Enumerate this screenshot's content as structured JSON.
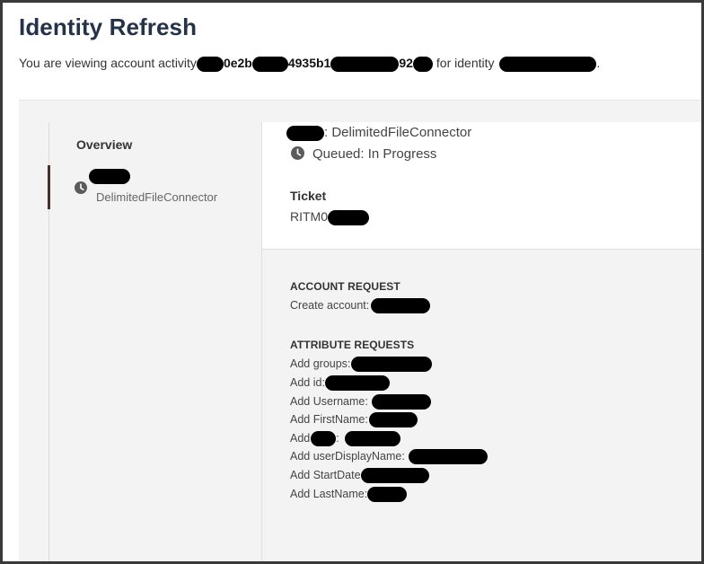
{
  "header": {
    "title": "Identity Refresh",
    "subtitle_prefix": "You are viewing account activity",
    "id_fragment_1": "0e2b",
    "id_fragment_2": "4935b1",
    "id_fragment_3": "92",
    "subtitle_middle": "for identity",
    "subtitle_end": "."
  },
  "nav": {
    "overview_label": "Overview",
    "active_item_subtitle": "DelimitedFileConnector"
  },
  "detail": {
    "connector_label": ": DelimitedFileConnector",
    "status_label": "Queued: In Progress",
    "ticket_heading": "Ticket",
    "ticket_prefix": "RITM0"
  },
  "account_request": {
    "heading": "ACCOUNT REQUEST",
    "line": "Create account:"
  },
  "attribute_requests": {
    "heading": "ATTRIBUTE REQUESTS",
    "items": [
      "Add groups:",
      "Add id:",
      "Add Username:",
      "Add FirstName:",
      "Add",
      "Add userDisplayName:",
      "Add StartDate",
      "Add LastName:"
    ],
    "item5_suffix": ":"
  },
  "icons": {
    "status_clock": "clock-icon",
    "nav_clock": "clock-icon"
  },
  "colors": {
    "title": "#24324a",
    "active_bar": "#4a2d2d",
    "panel_bg": "#f3f3f3"
  }
}
